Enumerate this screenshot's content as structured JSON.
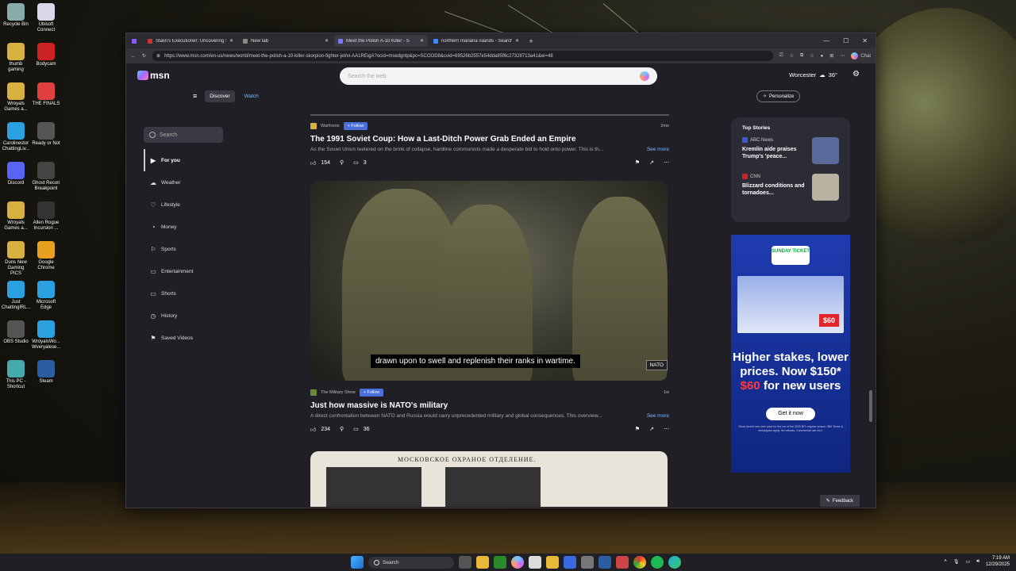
{
  "desktop": {
    "icons": [
      {
        "label": "Recycle Bin",
        "color": "#8aa"
      },
      {
        "label": "Ubisoft Connect",
        "color": "#d8d8e8"
      },
      {
        "label": "thumb gaming",
        "color": "#d8b040"
      },
      {
        "label": "Bodycam",
        "color": "#c22"
      },
      {
        "label": "Wroyals Games a...",
        "color": "#d8b040"
      },
      {
        "label": "THE FINALS",
        "color": "#e04040"
      },
      {
        "label": "Carolinestor ChattingLiv...",
        "color": "#2aa0e0"
      },
      {
        "label": "Ready or Not",
        "color": "#555"
      },
      {
        "label": "Discord",
        "color": "#5865f2"
      },
      {
        "label": "Ghost Recon Breakpoint",
        "color": "#444"
      },
      {
        "label": "Wroyals Games a...",
        "color": "#d8b040"
      },
      {
        "label": "Allen Rogue Incursion ...",
        "color": "#333"
      },
      {
        "label": "Duns New Gaming PICS",
        "color": "#d8b040"
      },
      {
        "label": "Google Chrome",
        "color": "#e8a020"
      },
      {
        "label": "Just ChattingIRL...",
        "color": "#2aa0e0"
      },
      {
        "label": "Microsoft Edge",
        "color": "#2aa0e0"
      },
      {
        "label": "OBS Studio",
        "color": "#555"
      },
      {
        "label": "WroyalsWo... Wveryalese...",
        "color": "#2aa0e0"
      },
      {
        "label": "This PC - Shortcut",
        "color": "#4aa"
      },
      {
        "label": "Steam",
        "color": "#2a5ea0"
      }
    ]
  },
  "browser": {
    "tabs": [
      {
        "title": "Stalin's Executioner: Uncovering S",
        "color": "#c33",
        "active": false
      },
      {
        "title": "New tab",
        "color": "#888",
        "active": false
      },
      {
        "title": "Meet the Polish A-10 Killer - S",
        "color": "#7a7aff",
        "active": true
      },
      {
        "title": "northern mariana islands - Search",
        "color": "#3a8aff",
        "active": false
      }
    ],
    "new_tab_label": "+",
    "url": "https://www.msn.com/en-us/news/world/meet-the-polish-a-10-killer-skorpion-fighter-jet/vi-AA1REigA?ocid=msedgntp&pc=SCOOD8&cvid=69526b2557e54dda85f6c27328713a41&ei=48",
    "chat_label": "Chat"
  },
  "msn": {
    "logo": "msn",
    "search_placeholder": "Search the web",
    "weather": {
      "city": "Worcester",
      "temp": "36°"
    },
    "nav": {
      "discover": "Discover",
      "watch": "Watch"
    },
    "personalize": "Personalize",
    "sidebar": {
      "search_placeholder": "Search",
      "items": [
        {
          "label": "For you",
          "icon": "▶"
        },
        {
          "label": "Weather",
          "icon": "☁"
        },
        {
          "label": "Lifestyle",
          "icon": "♡"
        },
        {
          "label": "Money",
          "icon": "◔"
        },
        {
          "label": "Sports",
          "icon": "⚐"
        },
        {
          "label": "Entertainment",
          "icon": "▭"
        },
        {
          "label": "Shorts",
          "icon": "▭"
        },
        {
          "label": "History",
          "icon": "◷"
        },
        {
          "label": "Saved Videos",
          "icon": "⚑"
        }
      ]
    },
    "articles": [
      {
        "source": "Warfronts",
        "follow": "Follow",
        "age": "2mo",
        "title": "The 1991 Soviet Coup: How a Last-Ditch Power Grab Ended an Empire",
        "desc": "As the Soviet Union teetered on the brink of collapse, hardline communists made a desperate bid to hold onto power. This is th...",
        "more": "See more",
        "likes": "154",
        "comments": "3"
      },
      {
        "source": "The Military Show",
        "follow": "Follow",
        "age": "1w",
        "title": "Just how massive is NATO's military",
        "desc": "A direct confrontation between NATO and Russia would carry unprecedented military and global consequences. This overview...",
        "more": "See more",
        "likes": "234",
        "comments": "36"
      }
    ],
    "video": {
      "caption": "drawn upon to swell and replenish their ranks in wartime.",
      "badge": "NATO"
    },
    "doc_text": "МОСКОВСКОЕ ОХРАНОЕ ОТДЕЛЕНИЕ.",
    "top_stories": {
      "title": "Top Stories",
      "items": [
        {
          "source": "ABC News",
          "headline": "Kremlin aide praises Trump's 'peace...",
          "thumb": "#5a6a9a"
        },
        {
          "source": "CNN",
          "headline": "Blizzard conditions and tornadoes...",
          "thumb": "#b8b0a0"
        }
      ]
    },
    "ad": {
      "brand": "SUNDAY TICKET",
      "price_badge": "$60",
      "headline_1": "Higher stakes, lower prices. Now $150*",
      "headline_red": "$60",
      "headline_2": " for new users",
      "cta": "Get it now",
      "fine": "*Must recent new user price for the run of the 2025 NFL regular season. $60 Terms & embargoes apply. No refunds. Commercial use excl."
    },
    "feedback": "Feedback"
  },
  "taskbar": {
    "search": "Search",
    "time": "7:19 AM",
    "date": "12/29/2025"
  }
}
